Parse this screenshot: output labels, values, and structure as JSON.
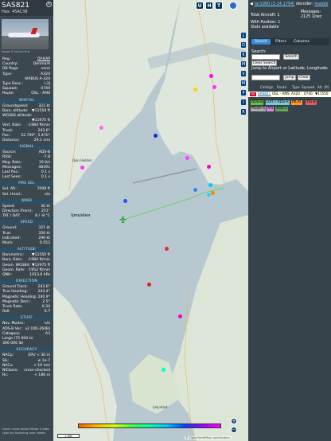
{
  "sidebar": {
    "callsign": "SAS821",
    "hex": "Hex: 45AC38",
    "photo_credit": "Image © Niclas Ferlo",
    "rows1": [
      {
        "k": "Reg.:",
        "v": "OY-KAP",
        "link": true
      },
      {
        "k": "Country:",
        "v": "Denmark"
      },
      {
        "k": "DB flags:",
        "v": "none"
      },
      {
        "k": "Type:",
        "v": "A320"
      },
      {
        "k": "",
        "v": "AIRBUS A-320"
      },
      {
        "k": "Type Desc.:",
        "v": "L2J"
      },
      {
        "k": "Squawk:",
        "v": "0740"
      },
      {
        "k": "Route:",
        "v": "OSL - AMS"
      }
    ],
    "sec_spatial": "SPATIAL",
    "rows2": [
      {
        "k": "Groundspeed:",
        "v": "321 kt"
      },
      {
        "k": "Baro. altitude:",
        "v": "▼11550 ft"
      },
      {
        "k": "WGS84 altitude:",
        "v": ""
      },
      {
        "k": "",
        "v": "▼11975 ft"
      },
      {
        "k": "Vert. Rate:",
        "v": "-1984 ft/min"
      },
      {
        "k": "Track:",
        "v": "243.6°"
      },
      {
        "k": "Pos.:",
        "v": "52.799°, 5.470°"
      },
      {
        "k": "Distance:",
        "v": "29.1 nmi"
      }
    ],
    "sec_signal": "SIGNAL",
    "rows3": [
      {
        "k": "Source:",
        "v": "ADS-B"
      },
      {
        "k": "RSSI:",
        "v": "-7.8"
      },
      {
        "k": "Msg. Rate:",
        "v": "10.0/s"
      },
      {
        "k": "Messages:",
        "v": "48391"
      },
      {
        "k": "Last Pos.:",
        "v": "0.1 s"
      },
      {
        "k": "Last Seen:",
        "v": "0.1 s"
      }
    ],
    "sec_fms": "FMS SEL",
    "rows4": [
      {
        "k": "Sel. Alt.:",
        "v": "7008 ft"
      },
      {
        "k": "Sel. Head.:",
        "v": "n/a"
      }
    ],
    "sec_wind": "WIND",
    "rows5": [
      {
        "k": "Speed:",
        "v": "30 kt"
      },
      {
        "k": "Direction (from):",
        "v": "251°"
      },
      {
        "k": "TAT / OAT:",
        "v": "8 / -8 °C"
      }
    ],
    "sec_speed": "SPEED",
    "rows6": [
      {
        "k": "Ground:",
        "v": "321 kt"
      },
      {
        "k": "True:",
        "v": "350 kt"
      },
      {
        "k": "Indicated:",
        "v": "299 kt"
      },
      {
        "k": "Mach:",
        "v": "0.552"
      }
    ],
    "sec_altitude": "ALTITUDE",
    "rows7": [
      {
        "k": "Barometric:",
        "v": "▼11550 ft"
      },
      {
        "k": "Baro. Rate:",
        "v": "-1984 ft/min"
      },
      {
        "k": "Geom. WGS84:",
        "v": "▼11975 ft"
      },
      {
        "k": "Geom. Rate:",
        "v": "-1952 ft/min"
      },
      {
        "k": "QNH:",
        "v": "1013.6 hPa"
      }
    ],
    "sec_direction": "DIRECTION",
    "rows8": [
      {
        "k": "Ground Track:",
        "v": "243.6°"
      },
      {
        "k": "True Heading:",
        "v": "243.4°"
      },
      {
        "k": "Magnetic Heading:",
        "v": "240.9°"
      },
      {
        "k": "Magnetic Decl.:",
        "v": "2.5°"
      },
      {
        "k": "Track Rate:",
        "v": "0.34"
      },
      {
        "k": "Roll:",
        "v": "6.7"
      }
    ],
    "sec_stuff": "STUFF",
    "rows9": [
      {
        "k": "Nav. Modes:",
        "v": "n/a"
      },
      {
        "k": "ADS-B Ver.:",
        "v": "v2 (DO-260B)"
      },
      {
        "k": "Category:",
        "v": "A3"
      },
      {
        "k": "Large (75 000 to",
        "v": ""
      },
      {
        "k": "300 000 lb)",
        "v": ""
      }
    ],
    "sec_accuracy": "ACCURACY",
    "rows10": [
      {
        "k": "NACp:",
        "v": "EPU < 30 m"
      },
      {
        "k": "SIL:",
        "v": "≤ 1e-7"
      },
      {
        "k": "NACv:",
        "v": "< 10 m/s"
      },
      {
        "k": "NICbaro:",
        "v": "cross-checked"
      },
      {
        "k": "Rc:",
        "v": "< 186 m"
      }
    ],
    "footer": "Learn more about Mode S data type by hovering over labels"
  },
  "map": {
    "buttons": [
      "U",
      "H",
      "T"
    ],
    "right_col": [
      "L",
      "O",
      "K",
      "M",
      "V",
      "M",
      "P",
      "I",
      "R"
    ],
    "zoom_in": "+",
    "zoom_out": "−",
    "scale": "1 NM",
    "attribution": "© OpenStreetMap contributors.",
    "place_labels": [
      "Den Helder",
      "Lelystad",
      "Ijmuiden"
    ]
  },
  "right": {
    "version": "tar1090 (3.14.1794)",
    "decoder_label": "decoder:",
    "decoder_link": "readsb",
    "total_aircraft": "Total Aircraft: 1",
    "messages_label": "Messages:",
    "messages_value": "2125 1/sec",
    "with_position": "With Position: 1",
    "stats": "Stats available",
    "tabs": [
      "Search",
      "Filters",
      "Columns"
    ],
    "search_label": "Search:",
    "search_button": "Search",
    "clear_search": "Clear Search",
    "jump_label": "Jump to Airport or Latitude, Longitude:",
    "jump_button": "Jump",
    "clear_button": "Clear",
    "columns": [
      "Callsign",
      "Route",
      "Type",
      "Squawk",
      "Alt. (ft)"
    ],
    "row": {
      "flag": "DK",
      "callsign": "SAS821",
      "route": "OSL - AMS",
      "type": "A320",
      "squawk": "0740",
      "alt": "▼11550"
    },
    "filter_chips": [
      {
        "label": "ADS-B",
        "color": "#6bbf3f"
      },
      {
        "label": "UAT / ADS-R",
        "color": "#7ec7d8"
      },
      {
        "label": "MLAT",
        "color": "#ff9933"
      },
      {
        "label": "TIS-B",
        "color": "#e06060"
      },
      {
        "label": "Mode-S",
        "color": "#aaaaaa"
      },
      {
        "label": "AIS",
        "color": "#dd88dd"
      },
      {
        "label": "ADS-C",
        "color": "#5ea35e"
      }
    ]
  }
}
